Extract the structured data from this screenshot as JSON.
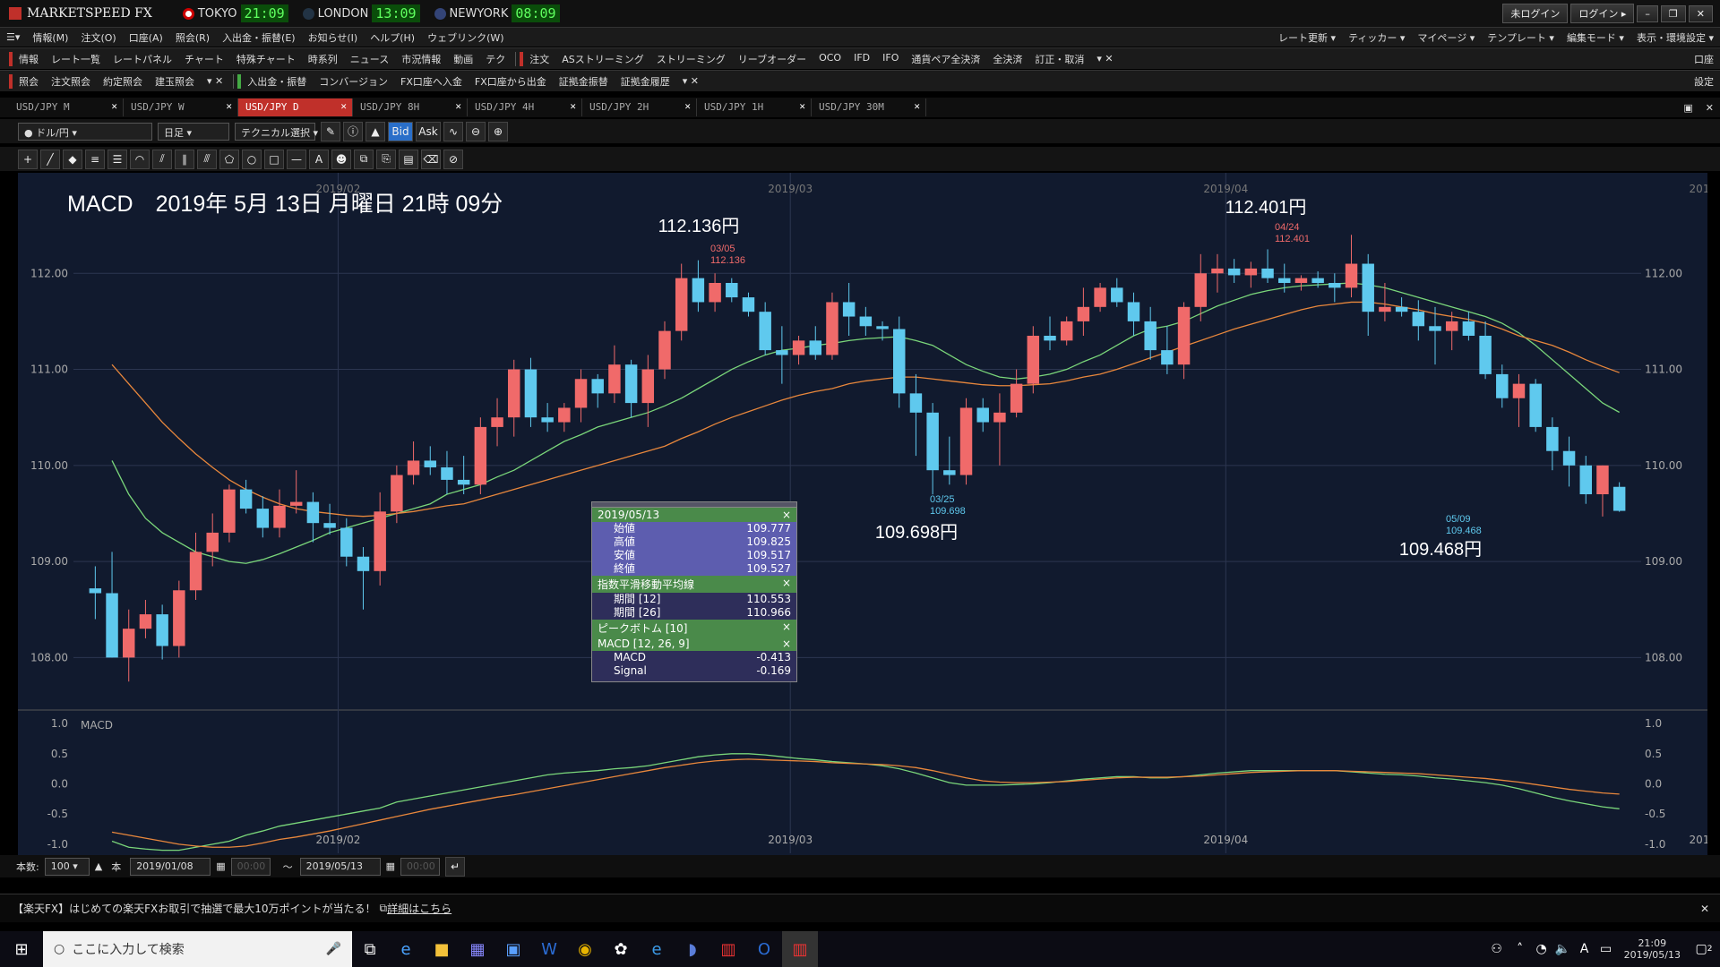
{
  "app": {
    "title": "MARKETSPEED FX",
    "clocks": [
      {
        "city": "TOKYO",
        "time": "21:09"
      },
      {
        "city": "LONDON",
        "time": "13:09"
      },
      {
        "city": "NEWYORK",
        "time": "08:09"
      }
    ],
    "login_status": "未ログイン",
    "login_button": "ログイン"
  },
  "menu": [
    "情報(M)",
    "注文(O)",
    "口座(A)",
    "照会(R)",
    "入出金・振替(E)",
    "お知らせ(I)",
    "ヘルプ(H)",
    "ウェブリンク(W)"
  ],
  "menu_right": [
    "レート更新",
    "ティッカー",
    "マイページ",
    "テンプレート",
    "編集モード",
    "表示・環境設定"
  ],
  "toolbar1": {
    "info_label": "情報",
    "items": [
      "レート一覧",
      "レートパネル",
      "チャート",
      "特殊チャート",
      "時系列",
      "ニュース",
      "市況情報",
      "動画",
      "テク"
    ],
    "order_label": "注文",
    "order_items": [
      "ASストリーミング",
      "ストリーミング",
      "リーブオーダー",
      "OCO",
      "IFD",
      "IFO",
      "通貨ペア全決済",
      "全決済",
      "訂正・取消"
    ],
    "right_label": "口座"
  },
  "toolbar2": {
    "inquiry_label": "照会",
    "items": [
      "注文照会",
      "約定照会",
      "建玉照会"
    ],
    "transfer_label": "入出金・振替",
    "transfer_items": [
      "コンバージョン",
      "FX口座へ入金",
      "FX口座から出金",
      "証拠金振替",
      "証拠金履歴"
    ],
    "right_label": "設定"
  },
  "tabs": [
    "USD/JPY M",
    "USD/JPY W",
    "USD/JPY D",
    "USD/JPY 8H",
    "USD/JPY 4H",
    "USD/JPY 2H",
    "USD/JPY 1H",
    "USD/JPY 30M"
  ],
  "active_tab": 2,
  "chart_toolbar": {
    "pair": "ドル/円",
    "period": "日足",
    "technical": "テクニカル選択",
    "bid": "Bid",
    "ask": "Ask"
  },
  "overlay": {
    "title": "MACD　2019年 5月 13日 月曜日 21時 09分",
    "high1": "112.136円",
    "high2": "112.401円",
    "low1": "109.698円",
    "low2": "109.468円",
    "peak_labels": [
      {
        "date": "03/05",
        "value": "112.136"
      },
      {
        "date": "04/24",
        "value": "112.401"
      },
      {
        "date": "03/25",
        "value": "109.698"
      },
      {
        "date": "05/09",
        "value": "109.468"
      }
    ]
  },
  "data_panel": {
    "date": "2019/05/13",
    "ohlc": [
      {
        "label": "始値",
        "value": "109.777"
      },
      {
        "label": "高値",
        "value": "109.825"
      },
      {
        "label": "安値",
        "value": "109.517"
      },
      {
        "label": "終値",
        "value": "109.527"
      }
    ],
    "ema_title": "指数平滑移動平均線",
    "ema": [
      {
        "label": "期間 [12]",
        "value": "110.553"
      },
      {
        "label": "期間 [26]",
        "value": "110.966"
      }
    ],
    "peak_title": "ピークボトム [10]",
    "macd_title": "MACD [12, 26, 9]",
    "macd": [
      {
        "label": "MACD",
        "value": "-0.413"
      },
      {
        "label": "Signal",
        "value": "-0.169"
      }
    ]
  },
  "bottom_controls": {
    "count_label": "本数:",
    "count": "100",
    "unit": "本",
    "from_date": "2019/01/08",
    "from_time": "00:00",
    "tilde": "～",
    "to_date": "2019/05/13",
    "to_time": "00:00"
  },
  "ad": {
    "text": "【楽天FX】はじめての楽天FXお取引で抽選で最大10万ポイントが当たる！",
    "link": "詳細はこちら"
  },
  "taskbar": {
    "search_placeholder": "ここに入力して検索",
    "time": "21:09",
    "date": "2019/05/13",
    "ime": "A",
    "notif": "2"
  },
  "colors": {
    "up": "#f06a6a",
    "down": "#5fc9ee",
    "ema12": "#7ad67a",
    "ema26": "#e8873c",
    "chart_bg": "#111a2e",
    "active_tab": "#c0302a"
  },
  "chart_data": {
    "type": "candlestick",
    "xlabels": [
      "2019/02",
      "2019/03",
      "2019/04",
      "2019/05"
    ],
    "ylabels": [
      "112.00",
      "111.00",
      "110.00",
      "109.00",
      "108.00"
    ],
    "ylim": [
      107.5,
      113.0
    ],
    "macd_ylabels": [
      "1.0",
      "0.5",
      "0.0",
      "-0.5",
      "-1.0"
    ],
    "macd_ylim": [
      -1.15,
      1.15
    ],
    "macd_label": "MACD",
    "candles": [
      [
        108.72,
        108.95,
        108.4,
        108.67
      ],
      [
        108.67,
        109.1,
        108.0,
        108.0
      ],
      [
        108.0,
        108.5,
        107.75,
        108.3
      ],
      [
        108.3,
        108.6,
        108.2,
        108.45
      ],
      [
        108.45,
        108.55,
        107.98,
        108.12
      ],
      [
        108.12,
        108.8,
        108.0,
        108.7
      ],
      [
        108.7,
        109.3,
        108.6,
        109.1
      ],
      [
        109.1,
        109.5,
        108.95,
        109.3
      ],
      [
        109.3,
        109.8,
        109.2,
        109.75
      ],
      [
        109.75,
        109.85,
        109.5,
        109.55
      ],
      [
        109.55,
        109.68,
        109.25,
        109.35
      ],
      [
        109.35,
        109.75,
        109.25,
        109.58
      ],
      [
        109.58,
        109.95,
        109.5,
        109.62
      ],
      [
        109.62,
        109.72,
        109.2,
        109.4
      ],
      [
        109.4,
        109.6,
        109.28,
        109.35
      ],
      [
        109.35,
        109.45,
        108.95,
        109.05
      ],
      [
        109.05,
        109.15,
        108.5,
        108.9
      ],
      [
        108.9,
        109.72,
        108.75,
        109.52
      ],
      [
        109.52,
        110.0,
        109.4,
        109.9
      ],
      [
        109.9,
        110.25,
        109.8,
        110.05
      ],
      [
        110.05,
        110.2,
        109.9,
        109.98
      ],
      [
        109.98,
        110.15,
        109.7,
        109.85
      ],
      [
        109.85,
        110.1,
        109.7,
        109.8
      ],
      [
        109.8,
        110.5,
        109.7,
        110.4
      ],
      [
        110.4,
        110.7,
        110.2,
        110.5
      ],
      [
        110.5,
        111.1,
        110.3,
        111.0
      ],
      [
        111.0,
        111.12,
        110.4,
        110.5
      ],
      [
        110.5,
        110.65,
        110.35,
        110.45
      ],
      [
        110.45,
        110.65,
        110.35,
        110.6
      ],
      [
        110.6,
        111.0,
        110.45,
        110.9
      ],
      [
        110.9,
        110.95,
        110.6,
        110.75
      ],
      [
        110.75,
        111.25,
        110.65,
        111.05
      ],
      [
        111.05,
        111.1,
        110.5,
        110.65
      ],
      [
        110.65,
        111.15,
        110.4,
        111.0
      ],
      [
        111.0,
        111.5,
        110.9,
        111.4
      ],
      [
        111.4,
        112.1,
        111.3,
        111.95
      ],
      [
        111.95,
        112.136,
        111.6,
        111.7
      ],
      [
        111.7,
        112.0,
        111.6,
        111.9
      ],
      [
        111.9,
        111.95,
        111.7,
        111.75
      ],
      [
        111.75,
        111.8,
        111.55,
        111.6
      ],
      [
        111.6,
        111.7,
        111.15,
        111.2
      ],
      [
        111.2,
        111.45,
        110.85,
        111.15
      ],
      [
        111.15,
        111.35,
        111.05,
        111.3
      ],
      [
        111.3,
        111.45,
        111.1,
        111.15
      ],
      [
        111.15,
        111.8,
        111.1,
        111.7
      ],
      [
        111.7,
        111.9,
        111.35,
        111.55
      ],
      [
        111.55,
        111.65,
        111.35,
        111.45
      ],
      [
        111.45,
        111.5,
        111.3,
        111.42
      ],
      [
        111.42,
        111.55,
        110.6,
        110.75
      ],
      [
        110.75,
        110.95,
        110.1,
        110.55
      ],
      [
        110.55,
        110.65,
        109.698,
        109.95
      ],
      [
        109.95,
        110.3,
        109.8,
        109.9
      ],
      [
        109.9,
        110.7,
        109.8,
        110.6
      ],
      [
        110.6,
        110.7,
        110.35,
        110.45
      ],
      [
        110.45,
        110.75,
        110.0,
        110.55
      ],
      [
        110.55,
        111.0,
        110.5,
        110.85
      ],
      [
        110.85,
        111.45,
        110.75,
        111.35
      ],
      [
        111.35,
        111.55,
        111.2,
        111.3
      ],
      [
        111.3,
        111.55,
        111.25,
        111.5
      ],
      [
        111.5,
        111.85,
        111.35,
        111.65
      ],
      [
        111.65,
        111.9,
        111.6,
        111.85
      ],
      [
        111.85,
        111.95,
        111.65,
        111.7
      ],
      [
        111.7,
        111.8,
        111.35,
        111.5
      ],
      [
        111.5,
        111.65,
        111.1,
        111.2
      ],
      [
        111.2,
        111.45,
        110.95,
        111.05
      ],
      [
        111.05,
        111.7,
        110.9,
        111.65
      ],
      [
        111.65,
        112.2,
        111.5,
        112.0
      ],
      [
        112.0,
        112.2,
        111.8,
        112.05
      ],
      [
        112.05,
        112.15,
        111.9,
        111.98
      ],
      [
        111.98,
        112.12,
        111.85,
        112.05
      ],
      [
        112.05,
        112.25,
        111.9,
        111.95
      ],
      [
        111.95,
        112.1,
        111.8,
        111.9
      ],
      [
        111.9,
        111.98,
        111.82,
        111.95
      ],
      [
        111.95,
        112.02,
        111.85,
        111.9
      ],
      [
        111.9,
        112.0,
        111.7,
        111.85
      ],
      [
        111.85,
        112.401,
        111.75,
        112.1
      ],
      [
        112.1,
        112.2,
        111.35,
        111.6
      ],
      [
        111.6,
        111.9,
        111.5,
        111.65
      ],
      [
        111.65,
        111.75,
        111.55,
        111.6
      ],
      [
        111.6,
        111.72,
        111.3,
        111.45
      ],
      [
        111.45,
        111.65,
        111.05,
        111.4
      ],
      [
        111.4,
        111.6,
        111.2,
        111.5
      ],
      [
        111.5,
        111.6,
        111.3,
        111.35
      ],
      [
        111.35,
        111.5,
        110.9,
        110.95
      ],
      [
        110.95,
        111.05,
        110.6,
        110.7
      ],
      [
        110.7,
        110.95,
        110.4,
        110.85
      ],
      [
        110.85,
        110.9,
        110.35,
        110.4
      ],
      [
        110.4,
        110.5,
        109.95,
        110.15
      ],
      [
        110.15,
        110.3,
        109.78,
        110.0
      ],
      [
        110.0,
        110.1,
        109.6,
        109.7
      ],
      [
        109.7,
        110.0,
        109.468,
        110.0
      ],
      [
        109.777,
        109.825,
        109.517,
        109.527
      ]
    ],
    "ema12": [
      110.05,
      109.7,
      109.45,
      109.3,
      109.2,
      109.1,
      109.05,
      109.0,
      108.98,
      109.02,
      109.08,
      109.15,
      109.22,
      109.3,
      109.35,
      109.4,
      109.45,
      109.5,
      109.55,
      109.6,
      109.7,
      109.75,
      109.8,
      109.88,
      109.95,
      110.05,
      110.15,
      110.25,
      110.32,
      110.4,
      110.45,
      110.5,
      110.55,
      110.62,
      110.7,
      110.8,
      110.9,
      111.0,
      111.08,
      111.15,
      111.2,
      111.22,
      111.25,
      111.27,
      111.3,
      111.32,
      111.33,
      111.34,
      111.3,
      111.25,
      111.15,
      111.05,
      110.98,
      110.92,
      110.9,
      110.92,
      110.95,
      111.0,
      111.08,
      111.15,
      111.25,
      111.35,
      111.42,
      111.45,
      111.5,
      111.58,
      111.66,
      111.72,
      111.78,
      111.82,
      111.85,
      111.87,
      111.88,
      111.89,
      111.9,
      111.88,
      111.85,
      111.8,
      111.75,
      111.7,
      111.65,
      111.6,
      111.55,
      111.48,
      111.38,
      111.25,
      111.1,
      110.95,
      110.8,
      110.65,
      110.553
    ],
    "ema26": [
      111.05,
      110.85,
      110.65,
      110.45,
      110.28,
      110.12,
      109.98,
      109.85,
      109.75,
      109.67,
      109.6,
      109.55,
      109.52,
      109.5,
      109.48,
      109.47,
      109.48,
      109.5,
      109.52,
      109.55,
      109.58,
      109.6,
      109.65,
      109.7,
      109.75,
      109.8,
      109.85,
      109.9,
      109.95,
      110.0,
      110.05,
      110.1,
      110.15,
      110.2,
      110.28,
      110.35,
      110.43,
      110.5,
      110.56,
      110.62,
      110.68,
      110.73,
      110.77,
      110.8,
      110.85,
      110.88,
      110.9,
      110.92,
      110.92,
      110.9,
      110.88,
      110.86,
      110.84,
      110.83,
      110.83,
      110.84,
      110.85,
      110.88,
      110.92,
      110.95,
      111.0,
      111.06,
      111.12,
      111.18,
      111.24,
      111.3,
      111.36,
      111.42,
      111.47,
      111.52,
      111.57,
      111.62,
      111.66,
      111.68,
      111.7,
      111.7,
      111.68,
      111.65,
      111.62,
      111.58,
      111.55,
      111.52,
      111.48,
      111.42,
      111.35,
      111.3,
      111.25,
      111.18,
      111.1,
      111.03,
      110.966
    ],
    "macd": [
      -0.95,
      -1.05,
      -1.08,
      -1.1,
      -1.1,
      -1.05,
      -1.0,
      -0.95,
      -0.85,
      -0.78,
      -0.7,
      -0.65,
      -0.6,
      -0.55,
      -0.5,
      -0.45,
      -0.4,
      -0.3,
      -0.25,
      -0.2,
      -0.15,
      -0.1,
      -0.05,
      0.0,
      0.05,
      0.1,
      0.15,
      0.18,
      0.2,
      0.22,
      0.25,
      0.27,
      0.3,
      0.35,
      0.4,
      0.45,
      0.48,
      0.5,
      0.5,
      0.48,
      0.45,
      0.42,
      0.4,
      0.37,
      0.35,
      0.33,
      0.3,
      0.25,
      0.18,
      0.1,
      0.02,
      -0.02,
      -0.02,
      -0.02,
      -0.01,
      0.0,
      0.02,
      0.05,
      0.08,
      0.1,
      0.12,
      0.12,
      0.1,
      0.1,
      0.12,
      0.15,
      0.18,
      0.2,
      0.22,
      0.22,
      0.22,
      0.22,
      0.22,
      0.22,
      0.2,
      0.18,
      0.16,
      0.15,
      0.13,
      0.1,
      0.08,
      0.05,
      0.02,
      -0.02,
      -0.08,
      -0.15,
      -0.22,
      -0.28,
      -0.33,
      -0.38,
      -0.413
    ],
    "signal": [
      -0.8,
      -0.85,
      -0.9,
      -0.95,
      -1.0,
      -1.03,
      -1.05,
      -1.05,
      -1.03,
      -0.98,
      -0.92,
      -0.88,
      -0.83,
      -0.78,
      -0.72,
      -0.66,
      -0.6,
      -0.54,
      -0.48,
      -0.42,
      -0.37,
      -0.32,
      -0.27,
      -0.22,
      -0.18,
      -0.13,
      -0.08,
      -0.03,
      0.02,
      0.07,
      0.12,
      0.17,
      0.22,
      0.27,
      0.31,
      0.35,
      0.38,
      0.4,
      0.41,
      0.4,
      0.39,
      0.38,
      0.37,
      0.35,
      0.34,
      0.33,
      0.32,
      0.3,
      0.27,
      0.22,
      0.16,
      0.1,
      0.05,
      0.03,
      0.02,
      0.02,
      0.03,
      0.04,
      0.06,
      0.08,
      0.1,
      0.11,
      0.11,
      0.11,
      0.12,
      0.13,
      0.15,
      0.17,
      0.19,
      0.2,
      0.21,
      0.22,
      0.22,
      0.22,
      0.21,
      0.2,
      0.19,
      0.18,
      0.17,
      0.15,
      0.13,
      0.11,
      0.09,
      0.06,
      0.03,
      -0.01,
      -0.05,
      -0.09,
      -0.12,
      -0.15,
      -0.169
    ]
  }
}
